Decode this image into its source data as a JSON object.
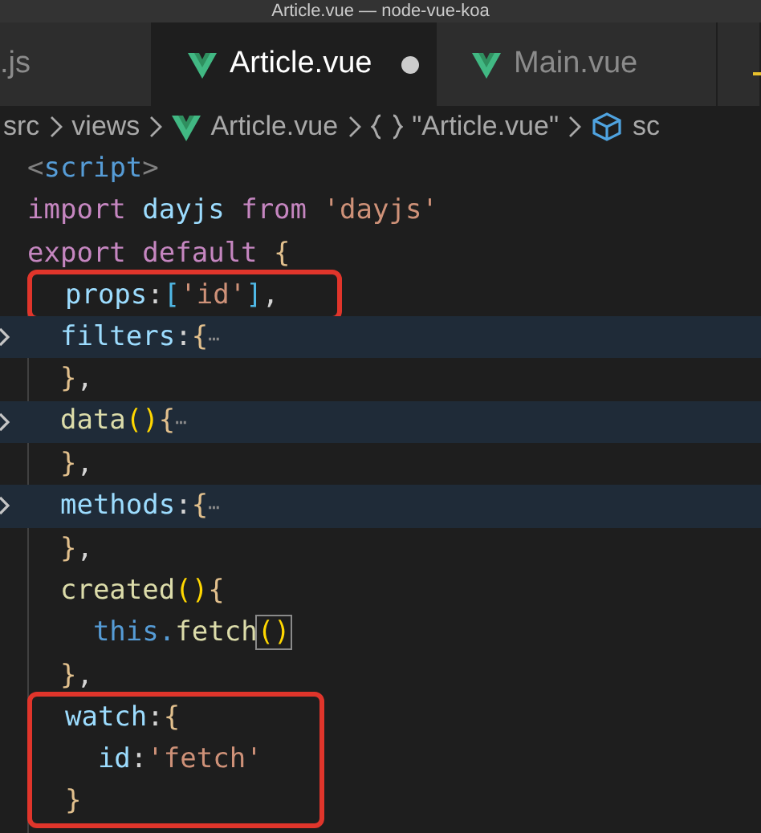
{
  "window": {
    "title": "Article.vue — node-vue-koa"
  },
  "tabs": [
    {
      "label": ".js",
      "kind": "plain",
      "selected": false,
      "modified": false
    },
    {
      "label": "Article.vue",
      "kind": "vue",
      "selected": true,
      "modified": true
    },
    {
      "label": "Main.vue",
      "kind": "vue",
      "selected": false,
      "modified": false
    },
    {
      "kind": "partial",
      "selected": false
    }
  ],
  "breadcrumb": [
    {
      "label": "src",
      "kind": "folder"
    },
    {
      "label": "views",
      "kind": "folder"
    },
    {
      "label": "Article.vue",
      "kind": "vue"
    },
    {
      "label": "\"Article.vue\"",
      "kind": "module"
    },
    {
      "label": "sc",
      "kind": "scope"
    }
  ],
  "editor": {
    "blocks": [
      {
        "outlined": false,
        "lines": [
          {
            "folded": false,
            "tokens": [
              {
                "kind": "tag",
                "text": "<"
              },
              {
                "kind": "tagname",
                "text": "script"
              },
              {
                "kind": "tag",
                "text": ">"
              }
            ]
          },
          {
            "folded": false,
            "tokens": [
              {
                "kind": "keyword",
                "text": "import "
              },
              {
                "kind": "ident",
                "text": "dayjs "
              },
              {
                "kind": "keyword",
                "text": "from "
              },
              {
                "kind": "string",
                "text": "'dayjs'"
              }
            ]
          },
          {
            "folded": false,
            "tokens": [
              {
                "kind": "keyword",
                "text": "export default "
              },
              {
                "kind": "punct",
                "text": "{"
              }
            ]
          }
        ]
      },
      {
        "outlined": true,
        "lines": [
          {
            "folded": false,
            "tokens": [
              {
                "kind": "ident",
                "text": "  props"
              },
              {
                "kind": "plain",
                "text": ":"
              },
              {
                "kind": "bracket2",
                "text": "["
              },
              {
                "kind": "string",
                "text": "'id'"
              },
              {
                "kind": "bracket2",
                "text": "]"
              },
              {
                "kind": "plain",
                "text": ","
              }
            ]
          }
        ]
      },
      {
        "outlined": false,
        "lines": [
          {
            "folded": true,
            "tokens": [
              {
                "kind": "ident",
                "text": "  filters"
              },
              {
                "kind": "plain",
                "text": ":"
              },
              {
                "kind": "punct",
                "text": "{"
              },
              {
                "kind": "ellipsis",
                "text": "⋯"
              }
            ]
          },
          {
            "folded": false,
            "tokens": [
              {
                "kind": "punct",
                "text": "  }"
              },
              {
                "kind": "plain",
                "text": ","
              }
            ]
          },
          {
            "folded": true,
            "tokens": [
              {
                "kind": "func",
                "text": "  data"
              },
              {
                "kind": "bracket",
                "text": "()"
              },
              {
                "kind": "punct",
                "text": "{"
              },
              {
                "kind": "ellipsis",
                "text": "⋯"
              }
            ]
          },
          {
            "folded": false,
            "tokens": [
              {
                "kind": "punct",
                "text": "  }"
              },
              {
                "kind": "plain",
                "text": ","
              }
            ]
          },
          {
            "folded": true,
            "tokens": [
              {
                "kind": "ident",
                "text": "  methods"
              },
              {
                "kind": "plain",
                "text": ":"
              },
              {
                "kind": "punct",
                "text": "{"
              },
              {
                "kind": "ellipsis",
                "text": "⋯"
              }
            ]
          },
          {
            "folded": false,
            "tokens": [
              {
                "kind": "punct",
                "text": "  }"
              },
              {
                "kind": "plain",
                "text": ","
              }
            ]
          },
          {
            "folded": false,
            "tokens": [
              {
                "kind": "func",
                "text": "  created"
              },
              {
                "kind": "bracket",
                "text": "()"
              },
              {
                "kind": "punct",
                "text": "{"
              }
            ]
          },
          {
            "folded": false,
            "tokens": [
              {
                "kind": "this",
                "text": "    this."
              },
              {
                "kind": "func",
                "text": "fetch"
              },
              {
                "kind": "bracketmatch",
                "text": "()"
              }
            ]
          },
          {
            "folded": false,
            "tokens": [
              {
                "kind": "punct",
                "text": "  }"
              },
              {
                "kind": "plain",
                "text": ","
              }
            ]
          }
        ]
      },
      {
        "outlined": true,
        "lines": [
          {
            "folded": false,
            "tokens": [
              {
                "kind": "ident",
                "text": "  watch"
              },
              {
                "kind": "plain",
                "text": ":"
              },
              {
                "kind": "punct",
                "text": "{"
              }
            ]
          },
          {
            "folded": false,
            "tokens": [
              {
                "kind": "ident",
                "text": "    id"
              },
              {
                "kind": "plain",
                "text": ":"
              },
              {
                "kind": "string",
                "text": "'fetch'"
              }
            ]
          },
          {
            "folded": false,
            "tokens": [
              {
                "kind": "punct",
                "text": "  }"
              }
            ]
          }
        ]
      }
    ]
  }
}
